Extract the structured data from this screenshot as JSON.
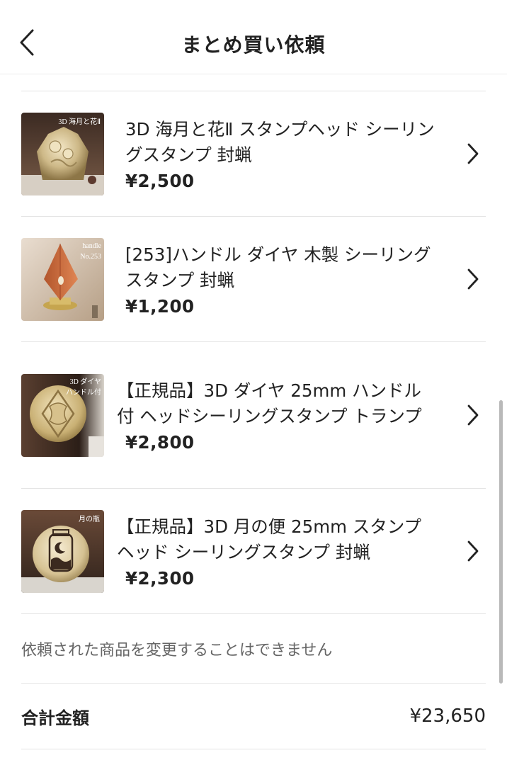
{
  "header": {
    "title": "まとめ買い依頼",
    "back_icon": "chevron-left-icon"
  },
  "items": [
    {
      "title": "3D 海月と花Ⅱ スタンプヘッド シーリングスタンプ 封蝋",
      "price": "¥2,500",
      "thumb_label": "3D 海月と花Ⅱ"
    },
    {
      "title": "[253]ハンドル ダイヤ 木製 シーリングスタンプ 封蝋",
      "price": "¥1,200",
      "thumb_label": "handle No.253"
    },
    {
      "title": "【正規品】3D ダイヤ 25mm ハンドル付 ヘッドシーリングスタンプ トランプ",
      "price": "¥2,800",
      "thumb_label": "3D ダイヤ ハンドル付"
    },
    {
      "title": "【正規品】3D 月の便 25mm スタンプヘッド シーリングスタンプ 封蝋",
      "price": "¥2,300",
      "thumb_label": "月の瓶"
    }
  ],
  "notice": "依頼された商品を変更することはできません",
  "total": {
    "label": "合計金額",
    "value": "¥23,650"
  },
  "colors": {
    "text": "#222222",
    "muted": "#666666",
    "divider": "#e4e4e4"
  }
}
